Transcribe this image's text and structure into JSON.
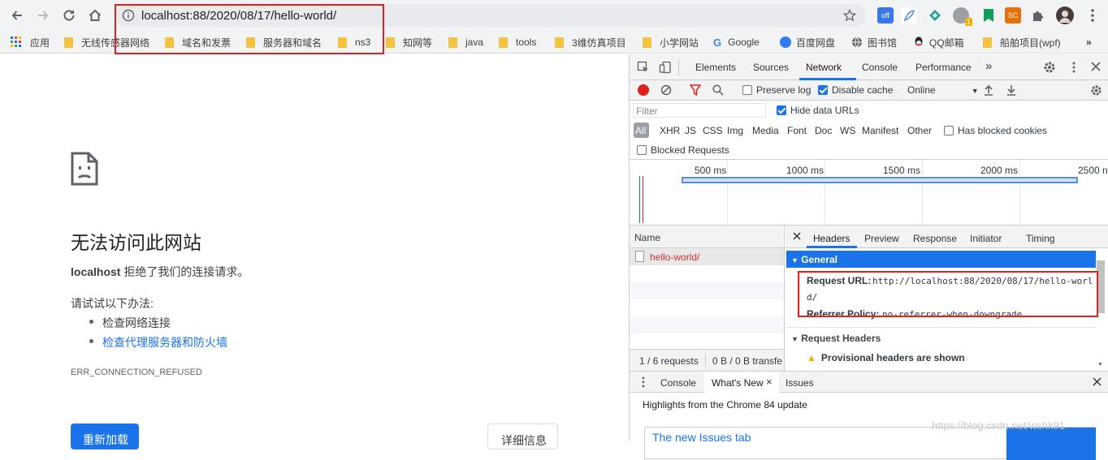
{
  "browser": {
    "url": "localhost:88/2020/08/17/hello-world/",
    "extensions": [
      {
        "icon": "extension-off-icon",
        "text": "off",
        "color": "#3b78e7"
      },
      {
        "icon": "feather-icon",
        "text": "",
        "color": "#4c8bf5"
      },
      {
        "icon": "diamond-icon",
        "text": "",
        "color": "#26a69a"
      },
      {
        "icon": "badge-icon",
        "text": "1",
        "color": "#f9ab00"
      },
      {
        "icon": "bookmark-green-icon",
        "text": "",
        "color": "#0f9d58"
      },
      {
        "icon": "sc-icon",
        "text": "SC",
        "color": "#e8710a"
      },
      {
        "icon": "puzzle-icon",
        "text": "",
        "color": "#5f6368"
      }
    ]
  },
  "bookmarks": [
    {
      "label": "应用",
      "icon": "apps-grid-icon"
    },
    {
      "label": "无线传感器网络",
      "icon": "folder-icon"
    },
    {
      "label": "域名和发票",
      "icon": "folder-icon"
    },
    {
      "label": "服务器和域名",
      "icon": "folder-icon"
    },
    {
      "label": "ns3",
      "icon": "folder-icon"
    },
    {
      "label": "知网等",
      "icon": "folder-icon"
    },
    {
      "label": "java",
      "icon": "folder-icon"
    },
    {
      "label": "tools",
      "icon": "folder-icon"
    },
    {
      "label": "3维仿真项目",
      "icon": "folder-icon"
    },
    {
      "label": "小学网站",
      "icon": "folder-icon"
    },
    {
      "label": "Google",
      "icon": "google-icon"
    },
    {
      "label": "百度网盘",
      "icon": "baidu-pan-icon"
    },
    {
      "label": "图书馆",
      "icon": "globe-icon"
    },
    {
      "label": "QQ邮箱",
      "icon": "qq-icon"
    },
    {
      "label": "船舶项目(wpf)",
      "icon": "folder-icon"
    }
  ],
  "error_page": {
    "title": "无法访问此网站",
    "host": "localhost",
    "host_message": " 拒绝了我们的连接请求。",
    "try_label": "请试试以下办法:",
    "suggestions": [
      "检查网络连接",
      "检查代理服务器和防火墙"
    ],
    "error_code": "ERR_CONNECTION_REFUSED",
    "reload_label": "重新加载",
    "details_label": "详细信息"
  },
  "devtools": {
    "tabs": [
      "Elements",
      "Sources",
      "Network",
      "Console",
      "Performance"
    ],
    "active_tab": "Network",
    "preserve_log": "Preserve log",
    "disable_cache": "Disable cache",
    "throttle": "Online",
    "filter_placeholder": "Filter",
    "hide_data_urls": "Hide data URLs",
    "filter_types": [
      "All",
      "XHR",
      "JS",
      "CSS",
      "Img",
      "Media",
      "Font",
      "Doc",
      "WS",
      "Manifest",
      "Other"
    ],
    "has_blocked_cookies": "Has blocked cookies",
    "blocked_requests": "Blocked Requests",
    "timeline_ticks": [
      "500 ms",
      "1000 ms",
      "1500 ms",
      "2000 ms",
      "2500 n"
    ],
    "name_header": "Name",
    "request_name": "hello-world/",
    "status_requests": "1 / 6 requests",
    "status_transfer": "0 B / 0 B transfe",
    "detail_tabs": [
      "Headers",
      "Preview",
      "Response",
      "Initiator",
      "Timing"
    ],
    "general_label": "General",
    "request_url_label": "Request URL:",
    "request_url_line1": "http://localhost:88/2020/08/17/hello-worl",
    "request_url_line2": "d/",
    "referrer_label": "Referrer Policy:",
    "referrer_value": "no-referrer-when-downgrade",
    "request_headers_label": "Request Headers",
    "provisional": "Provisional headers are shown",
    "drawer_tabs": [
      "Console",
      "What's New",
      "Issues"
    ],
    "highlights": "Highlights from the Chrome 84 update",
    "news_title": "The new Issues tab"
  },
  "watermark": "https://blog.csdn.net/wshk91"
}
